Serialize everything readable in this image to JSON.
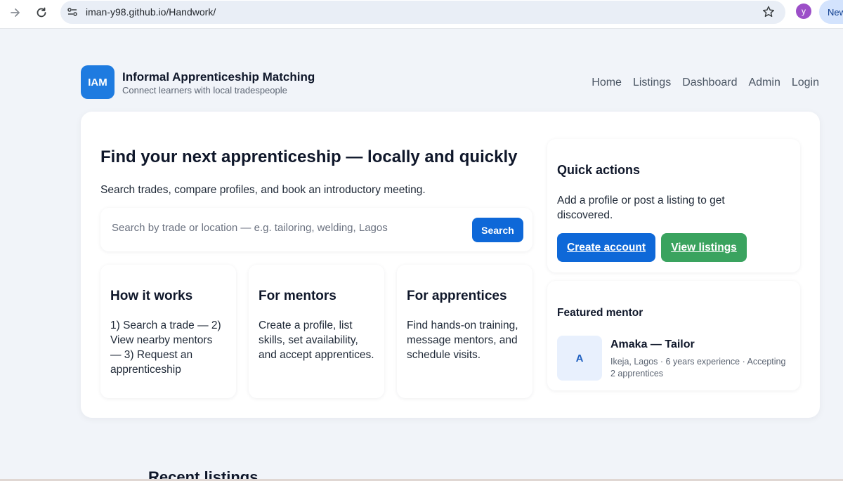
{
  "browser": {
    "url": "iman-y98.github.io/Handwork/",
    "profile_initial": "y",
    "new_chip_label": "New"
  },
  "brand": {
    "logo_text": "IAM",
    "title": "Informal Apprenticeship Matching",
    "subtitle": "Connect learners with local tradespeople"
  },
  "nav": {
    "home": "Home",
    "listings": "Listings",
    "dashboard": "Dashboard",
    "admin": "Admin",
    "login": "Login"
  },
  "hero": {
    "title": "Find your next apprenticeship — locally and quickly",
    "subtitle": "Search trades, compare profiles, and book an introductory meeting.",
    "search_placeholder": "Search by trade or location — e.g. tailoring, welding, Lagos",
    "search_button": "Search"
  },
  "info_cards": [
    {
      "title": "How it works",
      "text": "1) Search a trade — 2) View nearby mentors — 3) Request an apprenticeship"
    },
    {
      "title": "For mentors",
      "text": "Create a profile, list skills, set availability, and accept apprentices."
    },
    {
      "title": "For apprentices",
      "text": "Find hands-on training, message mentors, and schedule visits."
    }
  ],
  "quick_actions": {
    "title": "Quick actions",
    "text": "Add a profile or post a listing to get discovered.",
    "create_account": "Create account",
    "view_listings": "View listings"
  },
  "featured_mentor": {
    "title": "Featured mentor",
    "avatar_initial": "A",
    "name": "Amaka — Tailor",
    "meta": "Ikeja, Lagos · 6 years experience · Accepting 2 apprentices"
  },
  "recent": {
    "title": "Recent listings"
  },
  "colors": {
    "primary": "#0e68d8",
    "success": "#3aa35f",
    "background": "#f1f4f9"
  },
  "icons": [
    "forward-arrow-icon",
    "reload-icon",
    "site-info-icon",
    "star-icon"
  ]
}
